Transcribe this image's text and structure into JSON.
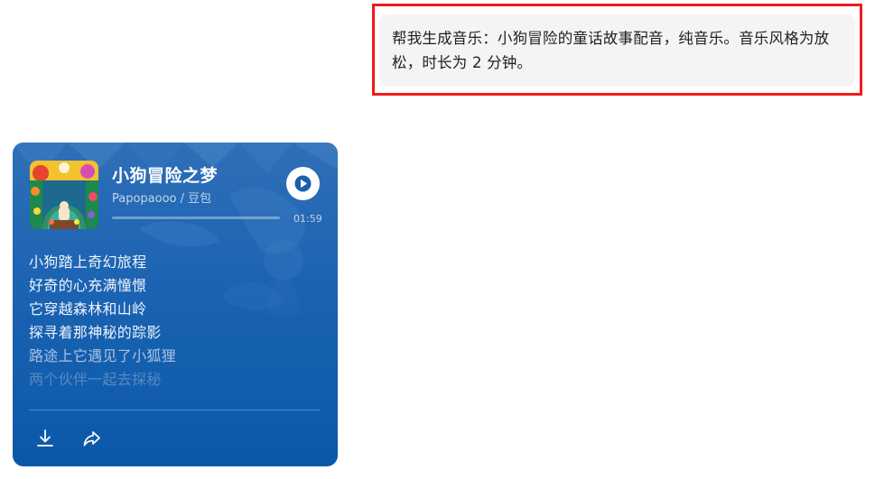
{
  "user_message": {
    "text": "帮我生成音乐：小狗冒险的童话故事配音，纯音乐。音乐风格为放松，时长为 2 分钟。"
  },
  "music_card": {
    "title": "小狗冒险之梦",
    "artist": "Papopaooo / 豆包",
    "duration": "01:59",
    "progress": 0,
    "play_icon": "play-icon",
    "lyrics": [
      "小狗踏上奇幻旅程",
      "好奇的心充满憧憬",
      "它穿越森林和山岭",
      "探寻着那神秘的踪影",
      "路途上它遇见了小狐狸",
      "两个伙伴一起去探秘"
    ],
    "actions": {
      "download_icon": "download-icon",
      "share_icon": "share-icon"
    }
  },
  "colors": {
    "highlight": "#ee1c1c",
    "bubble_bg": "#f4f4f5",
    "card_top": "#2f6fb6",
    "card_bottom": "#0b58a8"
  }
}
